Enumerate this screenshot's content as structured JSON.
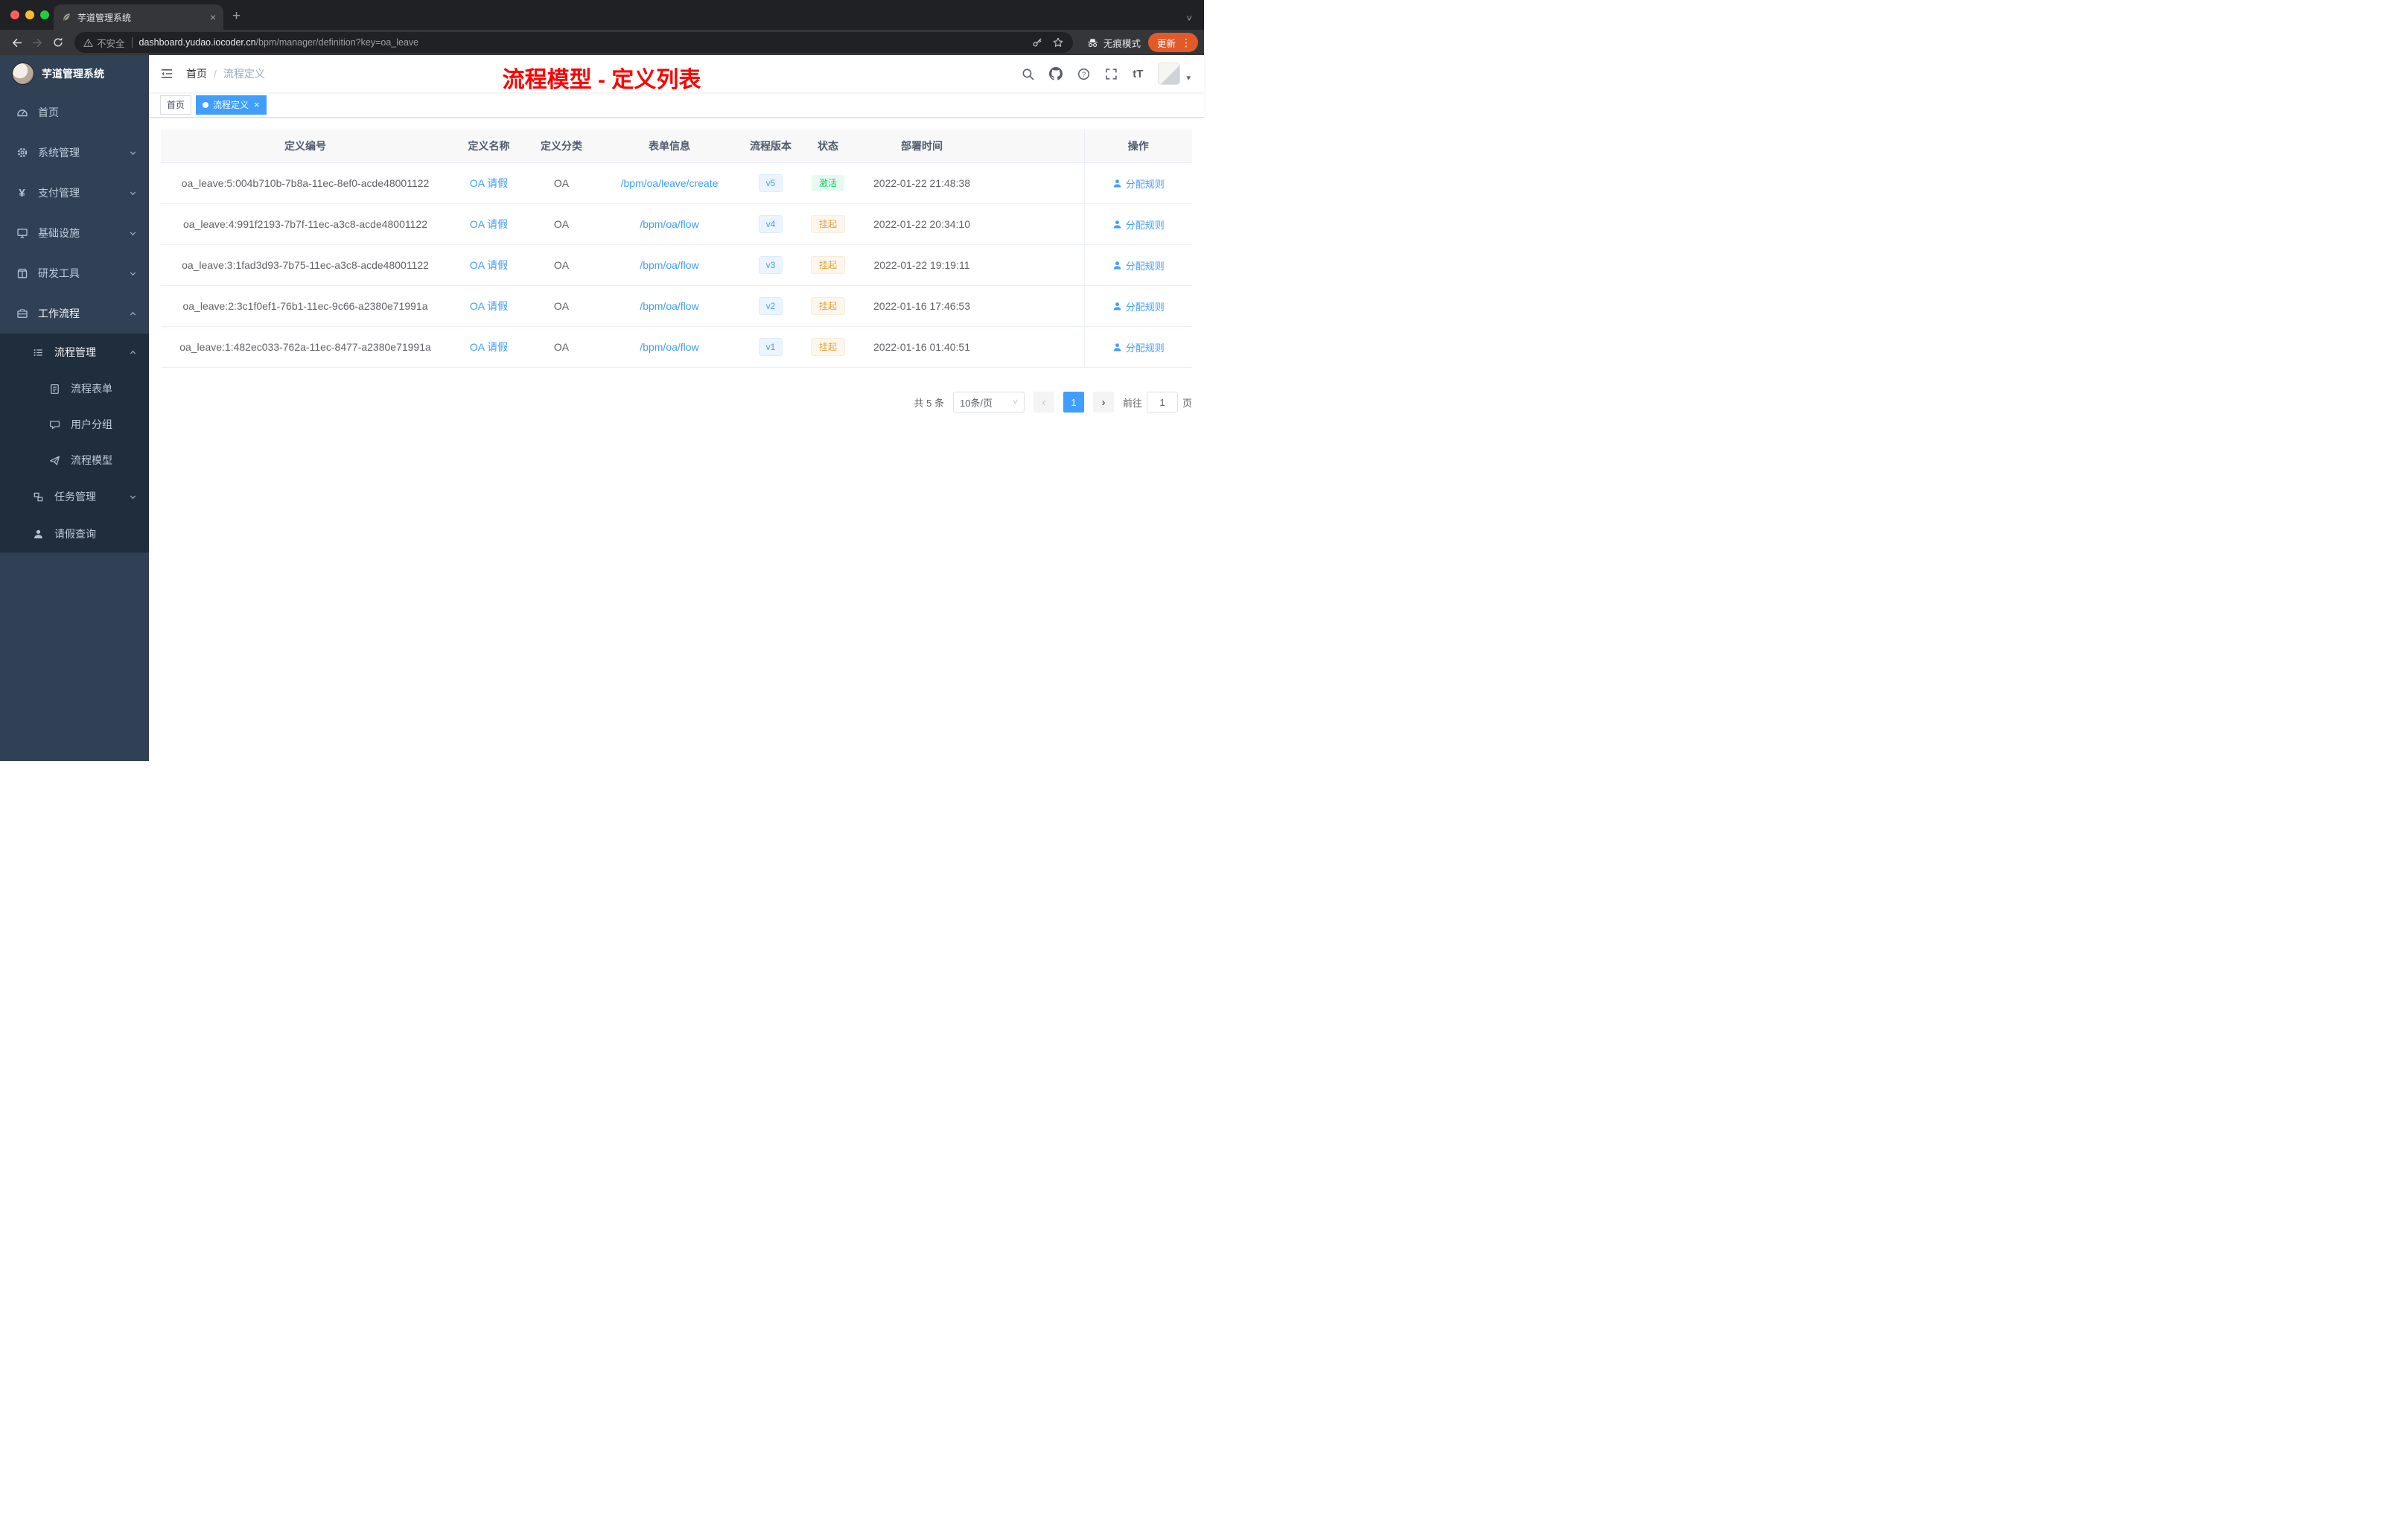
{
  "colors": {
    "accent": "#409eff",
    "annotation": "#ff0000",
    "success_text": "#13ce66",
    "success_bg": "#e7faf0",
    "warning_text": "#e6a23c",
    "warning_bg": "#fdf6ec",
    "sidebar_bg": "#304156",
    "sidebar_sub_bg": "#1f2d3d",
    "update_badge": "#e25a28"
  },
  "browser": {
    "tab_title": "芋道管理系统",
    "security_label": "不安全",
    "url_host": "dashboard.yudao.iocoder.cn",
    "url_path": "/bpm/manager/definition?key=oa_leave",
    "incognito_label": "无痕模式",
    "update_label": "更新"
  },
  "icons": {
    "close": "×",
    "plus": "+",
    "chevron": "˅",
    "kebab": "⋮",
    "caret": "▾",
    "text_size": "tT",
    "yen": "¥",
    "prev": "‹",
    "next": "›",
    "breadcrumb_sep": "/"
  },
  "sidebar": {
    "logo_title": "芋道管理系统",
    "items": [
      {
        "label": "首页"
      },
      {
        "label": "系统管理"
      },
      {
        "label": "支付管理"
      },
      {
        "label": "基础设施"
      },
      {
        "label": "研发工具"
      },
      {
        "label": "工作流程"
      }
    ],
    "submenu": {
      "process": {
        "label": "流程管理",
        "children": [
          {
            "label": "流程表单"
          },
          {
            "label": "用户分组"
          },
          {
            "label": "流程模型"
          }
        ]
      },
      "task": {
        "label": "任务管理"
      },
      "leave": {
        "label": "请假查询"
      }
    }
  },
  "header": {
    "breadcrumb_root": "首页",
    "breadcrumb_current": "流程定义",
    "annotation": "流程模型 - 定义列表"
  },
  "tags_view": {
    "home": "首页",
    "active": "流程定义"
  },
  "table": {
    "columns": [
      "定义编号",
      "定义名称",
      "定义分类",
      "表单信息",
      "流程版本",
      "状态",
      "部署时间",
      "操作"
    ],
    "rows": [
      {
        "id": "oa_leave:5:004b710b-7b8a-11ec-8ef0-acde48001122",
        "name": "OA 请假",
        "category": "OA",
        "form": "/bpm/oa/leave/create",
        "version": "v5",
        "status": "激活",
        "deploy_time": "2022-01-22 21:48:38",
        "action": "分配规则"
      },
      {
        "id": "oa_leave:4:991f2193-7b7f-11ec-a3c8-acde48001122",
        "name": "OA 请假",
        "category": "OA",
        "form": "/bpm/oa/flow",
        "version": "v4",
        "status": "挂起",
        "deploy_time": "2022-01-22 20:34:10",
        "action": "分配规则"
      },
      {
        "id": "oa_leave:3:1fad3d93-7b75-11ec-a3c8-acde48001122",
        "name": "OA 请假",
        "category": "OA",
        "form": "/bpm/oa/flow",
        "version": "v3",
        "status": "挂起",
        "deploy_time": "2022-01-22 19:19:11",
        "action": "分配规则"
      },
      {
        "id": "oa_leave:2:3c1f0ef1-76b1-11ec-9c66-a2380e71991a",
        "name": "OA 请假",
        "category": "OA",
        "form": "/bpm/oa/flow",
        "version": "v2",
        "status": "挂起",
        "deploy_time": "2022-01-16 17:46:53",
        "action": "分配规则"
      },
      {
        "id": "oa_leave:1:482ec033-762a-11ec-8477-a2380e71991a",
        "name": "OA 请假",
        "category": "OA",
        "form": "/bpm/oa/flow",
        "version": "v1",
        "status": "挂起",
        "deploy_time": "2022-01-16 01:40:51",
        "action": "分配规则"
      }
    ]
  },
  "pagination": {
    "total": "共 5 条",
    "page_size": "10条/页",
    "page": "1",
    "goto_label": "前往",
    "goto_value": "1",
    "unit": "页"
  }
}
